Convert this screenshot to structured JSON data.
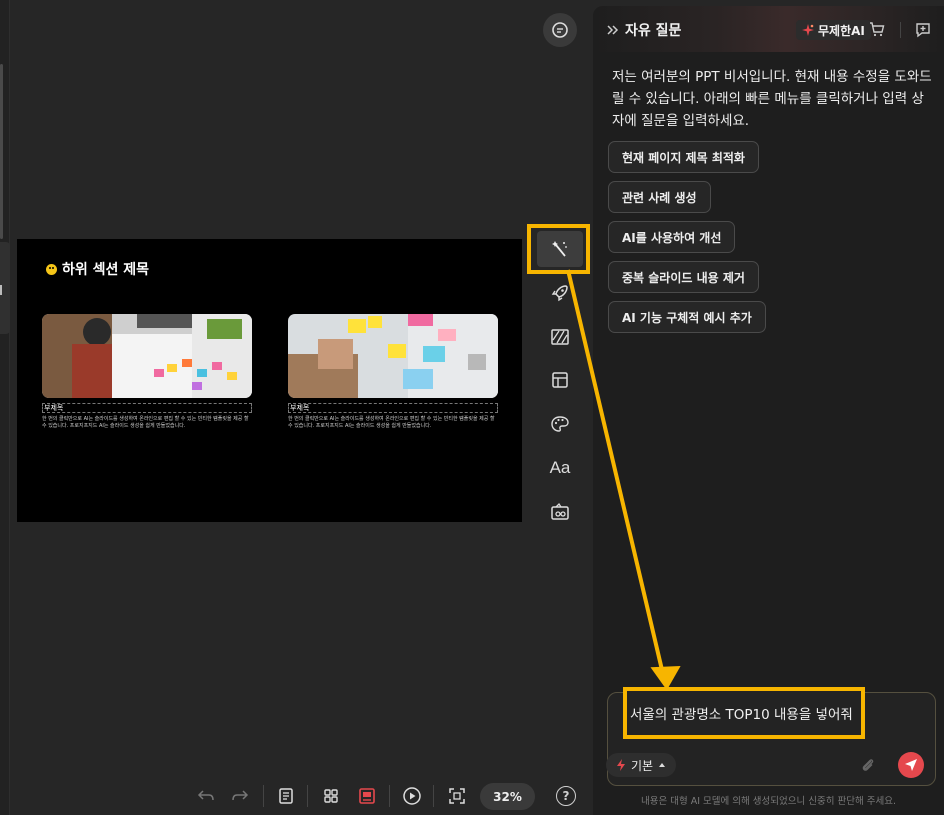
{
  "slide": {
    "title": "하위 섹션 제목",
    "cards": [
      {
        "subtitle": "부제목",
        "body": "한 번의 클릭만으로 AI는 슬라이드를 생성하여 온라인으로 편집 할 수 있는 빈티한 템플릿을 제공 할 수 있습니다. 프로지프지드 AI는 슬라이드 생성을 쉽게 만들었습니다."
      },
      {
        "subtitle": "부제목",
        "body": "한 번의 클릭만으로 AI는 슬라이드를 생성하여 온라인으로 편집 할 수 있는 빈티한 템플릿을 제공 할 수 있습니다. 프로지프지드 AI는 슬라이드 생성을 쉽게 만들었습니다."
      }
    ]
  },
  "rail": {
    "icons": [
      "chat-bubble-icon",
      "magic-wand-icon",
      "rocket-icon",
      "pattern-icon",
      "layout-icon",
      "palette-icon",
      "font-icon",
      "gift-card-icon"
    ],
    "font_label": "Aa"
  },
  "panel": {
    "title": "자유 질문",
    "badge": "무제한AI",
    "intro": "저는 여러분의 PPT 비서입니다. 현재 내용 수정을 도와드릴 수 있습니다. 아래의 빠른 메뉴를 클릭하거나 입력 상자에 질문을 입력하세요.",
    "quick_actions": [
      "현재 페이지 제목 최적화",
      "관련 사례 생성",
      "AI를 사용하여 개선",
      "중복 슬라이드 내용 제거",
      "AI 기능 구체적 예시 추가"
    ],
    "input_value": "서울의 관광명소 TOP10 내용을 넣어줘",
    "mode_label": "기본",
    "disclaimer": "내용은 대형 AI 모델에 의해 생성되었으니 신중히 판단해 주세요."
  },
  "toolbar": {
    "zoom": "32%",
    "help": "?"
  },
  "colors": {
    "highlight": "#f7b500",
    "send": "#e5484d",
    "panel_bg": "#1e1e1e",
    "canvas_bg": "#262626"
  }
}
